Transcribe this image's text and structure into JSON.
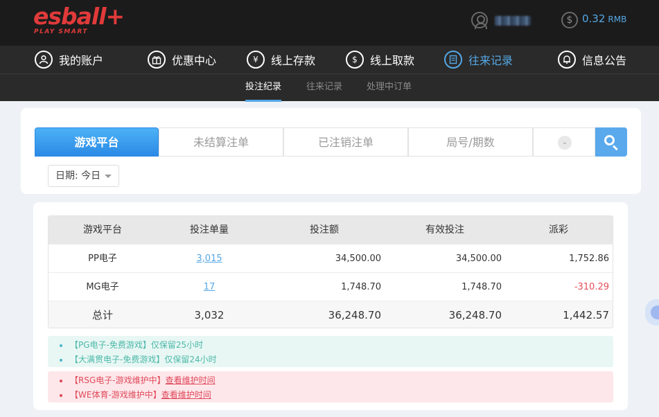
{
  "brand": {
    "logo": "esball+",
    "tagline": "PLAY SMART"
  },
  "header": {
    "balance": "0.32",
    "currency": "RMB"
  },
  "nav": [
    {
      "label": "我的账户",
      "icon": "user-icon"
    },
    {
      "label": "优惠中心",
      "icon": "gift-icon"
    },
    {
      "label": "线上存款",
      "icon": "deposit-icon"
    },
    {
      "label": "线上取款",
      "icon": "withdraw-icon"
    },
    {
      "label": "往来记录",
      "icon": "records-icon",
      "active": true
    },
    {
      "label": "信息公告",
      "icon": "bell-icon"
    }
  ],
  "subnav": [
    {
      "label": "投注纪录",
      "active": true
    },
    {
      "label": "往来记录"
    },
    {
      "label": "处理中订单"
    }
  ],
  "tabs": [
    {
      "label": "游戏平台",
      "active": true
    },
    {
      "label": "未结算注单"
    },
    {
      "label": "已注销注单"
    },
    {
      "label": "局号/期数"
    }
  ],
  "filter": {
    "date_label": "日期: 今日"
  },
  "table": {
    "headers": [
      "游戏平台",
      "投注单量",
      "投注额",
      "有效投注",
      "派彩"
    ],
    "rows": [
      {
        "platform": "PP电子",
        "count": "3,015",
        "bet": "34,500.00",
        "valid": "34,500.00",
        "payout": "1,752.86"
      },
      {
        "platform": "MG电子",
        "count": "17",
        "bet": "1,748.70",
        "valid": "1,748.70",
        "payout": "-310.29"
      }
    ],
    "total": {
      "label": "总计",
      "count": "3,032",
      "bet": "36,248.70",
      "valid": "36,248.70",
      "payout": "1,442.57"
    }
  },
  "notices": {
    "green": [
      "【PG电子-免费游戏】仅保留25小时",
      "【大满贯电子-免费游戏】仅保留24小时"
    ],
    "red": [
      {
        "text": "【RSG电子-游戏维护中】",
        "link": "查看维护时间"
      },
      {
        "text": "【WE体育-游戏维护中】",
        "link": "查看维护时间"
      }
    ]
  },
  "colors": {
    "accent": "#55a8e6",
    "brand": "#e03a3a",
    "negative": "#e84d5a",
    "notice_green": "#4cb8a8",
    "notice_red": "#e0485a"
  }
}
